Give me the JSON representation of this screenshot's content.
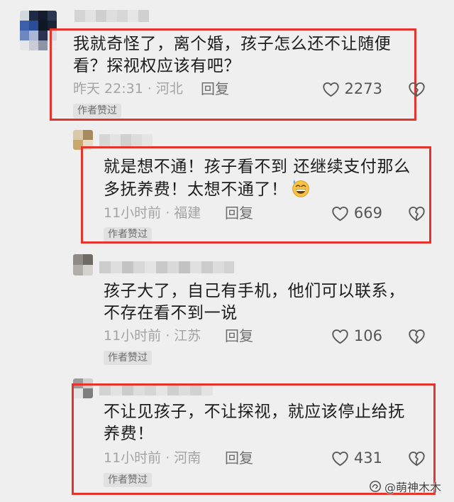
{
  "colors": {
    "background": "#efefef",
    "highlight_box": "#e4342b",
    "comment_text": "#1c1c1c",
    "meta_text": "#a3a3a3"
  },
  "separator": "·",
  "icons": {
    "like": "heart-outline",
    "dislike": "broken-heart"
  },
  "comments": [
    {
      "highlighted": true,
      "lines": [
        "我就奇怪了，离个婚，孩子怎么还不让随便",
        "看？探视权应该有吧？"
      ],
      "time": "昨天 22:31",
      "location": "河北",
      "reply_label": "回复",
      "likes": "2273",
      "badge": "作者赞过"
    },
    {
      "highlighted": true,
      "lines": [
        "就是想不通！孩子看不到 还继续支付那么",
        "多抚养费！太想不通了！"
      ],
      "emoji": "grinning-face-with-sweat",
      "time": "11小时前",
      "location": "福建",
      "reply_label": "回复",
      "likes": "669",
      "badge": "作者赞过"
    },
    {
      "highlighted": false,
      "lines": [
        "孩子大了，自己有手机，他们可以联系，",
        "不存在看不到一说"
      ],
      "time": "11小时前",
      "location": "江苏",
      "reply_label": "回复",
      "likes": "106",
      "badge": "作者赞过"
    },
    {
      "highlighted": true,
      "lines": [
        "不让见孩子，不让探视，就应该停止给抚",
        "养费！"
      ],
      "time": "11小时前",
      "location": "河南",
      "reply_label": "回复",
      "likes": "431",
      "badge": "作者赞过"
    }
  ],
  "watermark": {
    "text": "@萌神木木",
    "icon": "watermark-logo"
  }
}
